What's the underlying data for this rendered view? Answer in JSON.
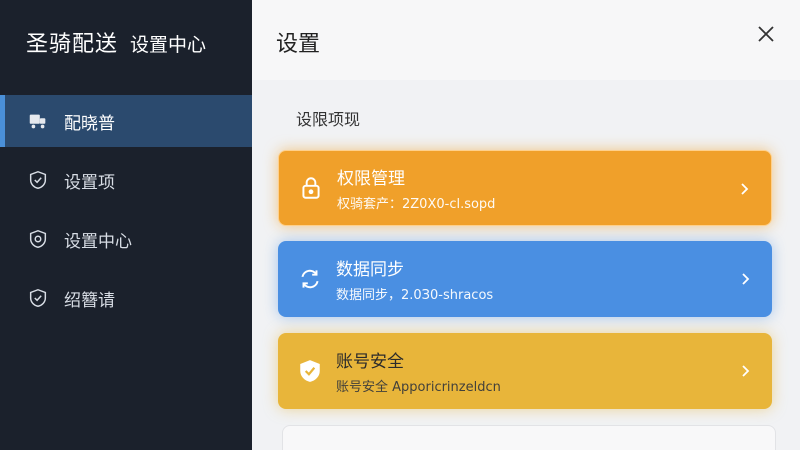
{
  "sidebar": {
    "brand_name": "圣骑配送",
    "brand_sub": "设置中心",
    "items": [
      {
        "label": "配晓普",
        "icon": "delivery-truck-icon"
      },
      {
        "label": "设置项",
        "icon": "shield-check-icon"
      },
      {
        "label": "设置中心",
        "icon": "gear-shield-icon"
      },
      {
        "label": "绍簪请",
        "icon": "shield-check-icon"
      }
    ]
  },
  "main": {
    "title": "设置",
    "section_title": "设限项现",
    "cards": [
      {
        "title": "权限管理",
        "subtitle": "权骑套产：2Z0X0-cl.sopd",
        "icon": "lock-icon",
        "color": "#f0a02a"
      },
      {
        "title": "数据同步",
        "subtitle": "数据同步，2.0З0-shracos",
        "icon": "sync-icon",
        "color": "#4a8fe2"
      },
      {
        "title": "账号安全",
        "subtitle": "账号安全 Apporicrinzeldcn",
        "icon": "shield-check-icon",
        "color": "#e8b53a"
      }
    ]
  },
  "colors": {
    "sidebar_bg": "#1b212c",
    "active_item_bg": "#2b4a6e",
    "accent_blue": "#4a90d9"
  }
}
